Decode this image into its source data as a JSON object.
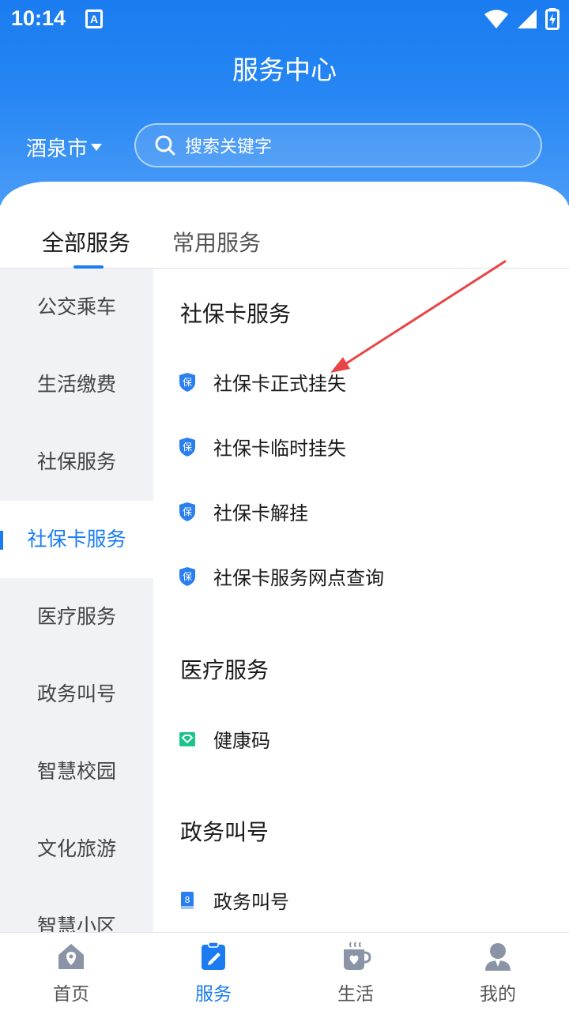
{
  "status": {
    "time": "10:14",
    "app_badge": "A"
  },
  "page": {
    "title": "服务中心"
  },
  "location": {
    "city": "酒泉市"
  },
  "search": {
    "placeholder": "搜索关键字"
  },
  "tabs": [
    {
      "label": "全部服务",
      "active": true
    },
    {
      "label": "常用服务",
      "active": false
    }
  ],
  "sidebar": {
    "items": [
      {
        "label": "公交乘车"
      },
      {
        "label": "生活缴费"
      },
      {
        "label": "社保服务"
      },
      {
        "label": "社保卡服务",
        "active": true
      },
      {
        "label": "医疗服务"
      },
      {
        "label": "政务叫号"
      },
      {
        "label": "智慧校园"
      },
      {
        "label": "文化旅游"
      },
      {
        "label": "智慧小区"
      }
    ]
  },
  "sections": [
    {
      "title": "社保卡服务",
      "items": [
        {
          "label": "社保卡正式挂失",
          "icon": "shield-bao-icon"
        },
        {
          "label": "社保卡临时挂失",
          "icon": "shield-bao-icon"
        },
        {
          "label": "社保卡解挂",
          "icon": "shield-bao-icon"
        },
        {
          "label": "社保卡服务网点查询",
          "icon": "shield-bao-icon"
        }
      ]
    },
    {
      "title": "医疗服务",
      "items": [
        {
          "label": "健康码",
          "icon": "health-code-icon"
        }
      ]
    },
    {
      "title": "政务叫号",
      "items": [
        {
          "label": "政务叫号",
          "icon": "queue-ticket-icon"
        }
      ]
    }
  ],
  "bottom_nav": [
    {
      "label": "首页",
      "icon": "home-icon"
    },
    {
      "label": "服务",
      "icon": "service-clipboard-icon",
      "active": true
    },
    {
      "label": "生活",
      "icon": "coffee-cup-icon"
    },
    {
      "label": "我的",
      "icon": "user-profile-icon"
    }
  ],
  "colors": {
    "primary": "#1a7cf0",
    "sidebar_bg": "#f1f2f6",
    "annotation_arrow": "#e84545",
    "health_green": "#1cc48b"
  }
}
